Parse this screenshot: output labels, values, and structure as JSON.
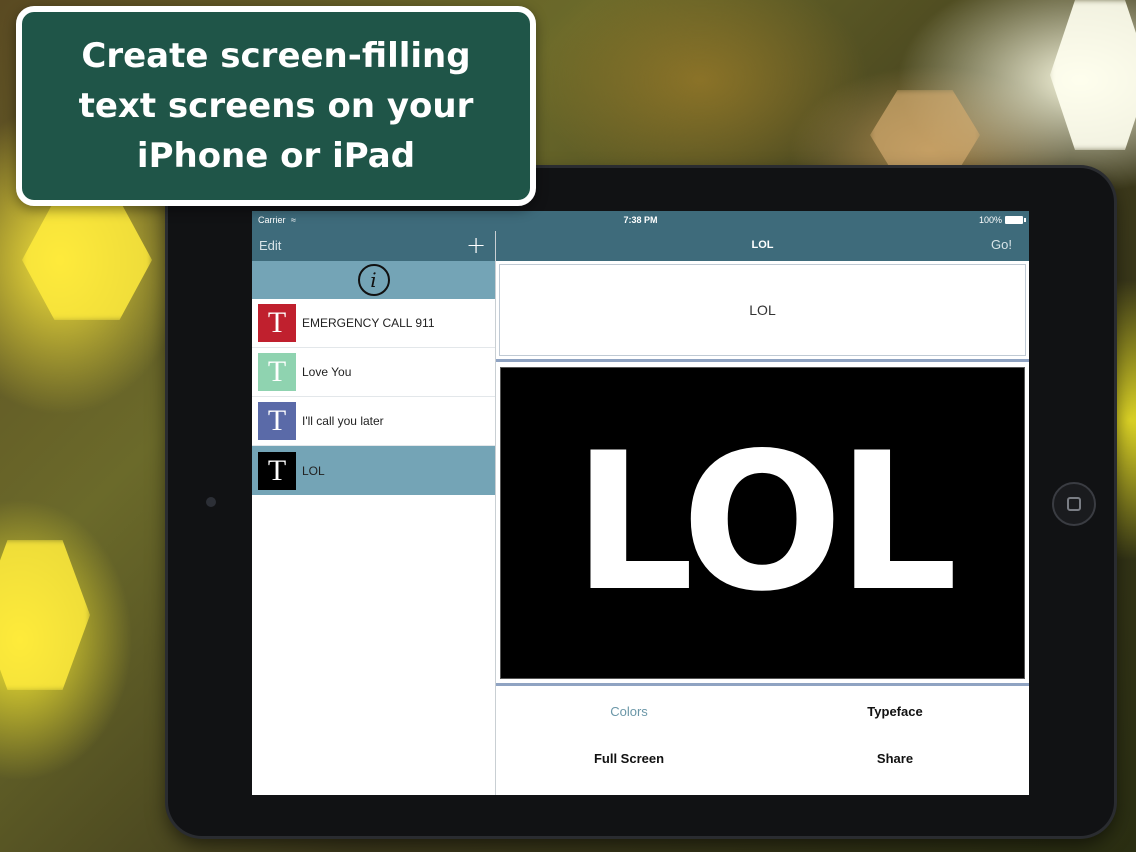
{
  "banner": {
    "text": "Create screen-filling text screens on your iPhone or iPad"
  },
  "status_bar": {
    "carrier": "Carrier",
    "time": "7:38 PM",
    "battery": "100%"
  },
  "sidebar": {
    "edit_label": "Edit",
    "add_label": "+",
    "info_label": "i",
    "items": [
      {
        "label": "EMERGENCY CALL 911",
        "thumb_letter": "T",
        "thumb_color": "#c0202e",
        "selected": false
      },
      {
        "label": "Love You",
        "thumb_letter": "T",
        "thumb_color": "#8fd3b0",
        "selected": false
      },
      {
        "label": "I'll call you later",
        "thumb_letter": "T",
        "thumb_color": "#5a6aa8",
        "selected": false
      },
      {
        "label": "LOL",
        "thumb_letter": "T",
        "thumb_color": "#000000",
        "selected": true
      }
    ]
  },
  "detail": {
    "title": "LOL",
    "go_label": "Go!",
    "input_value": "LOL",
    "preview_text": "LOL",
    "actions": {
      "colors": "Colors",
      "typeface": "Typeface",
      "full_screen": "Full Screen",
      "share": "Share"
    }
  },
  "colors": {
    "nav_bar": "#3e6b7b",
    "selected_row": "#74a4b6",
    "banner_bg": "#1f5548"
  }
}
